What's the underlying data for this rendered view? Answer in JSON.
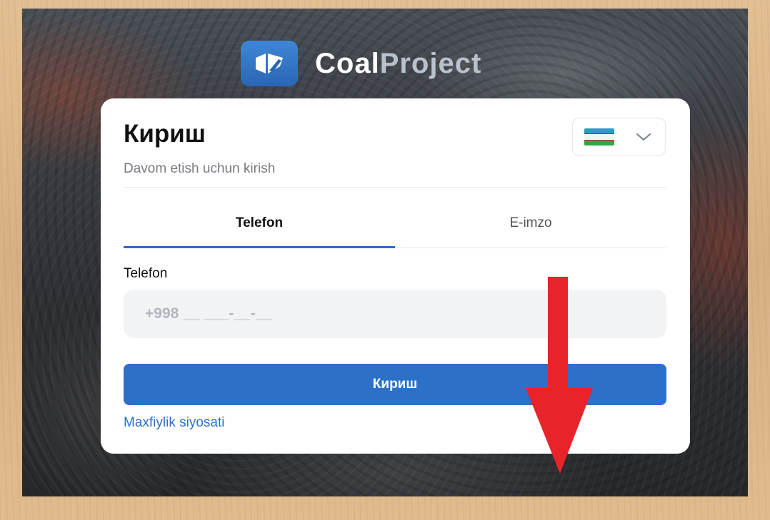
{
  "brand": {
    "name_part1": "Coal",
    "name_part2": "Project",
    "icon": "coalproject-logo-icon",
    "color": "#2b6fc7"
  },
  "login": {
    "title": "Кириш",
    "subtitle": "Davom etish uchun kirish",
    "language": {
      "selected": "uz",
      "flag_icon": "uzbekistan-flag-icon",
      "chevron_icon": "chevron-down-icon"
    },
    "tabs": [
      {
        "label": "Telefon",
        "active": true
      },
      {
        "label": "E-imzo",
        "active": false
      }
    ],
    "phone": {
      "label": "Telefon",
      "placeholder": "+998 __ ___-__-__",
      "value": ""
    },
    "submit_label": "Кириш",
    "privacy_link": "Maxfiylik siyosati"
  },
  "annotation": {
    "icon": "red-down-arrow",
    "color": "#e8232a"
  }
}
